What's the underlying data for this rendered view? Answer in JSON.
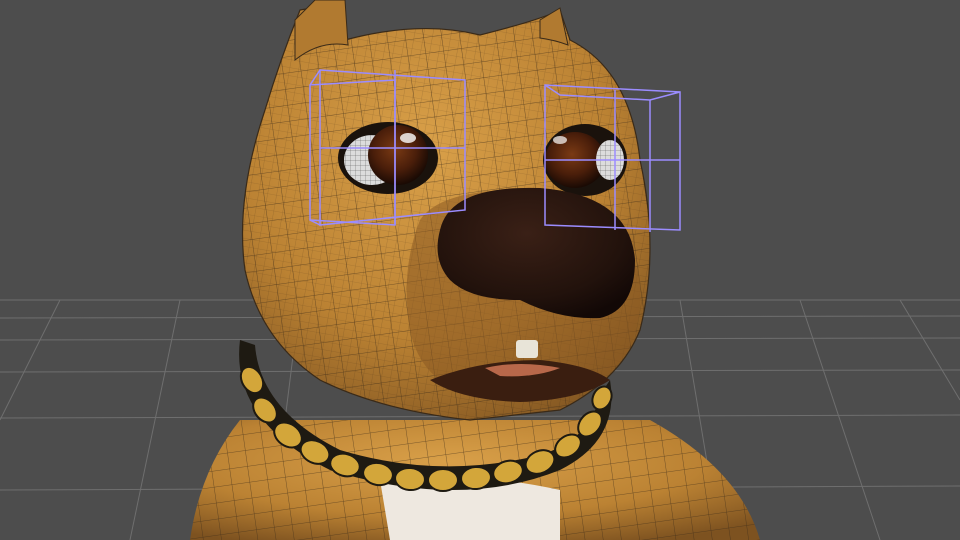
{
  "app": {
    "name": ""
  },
  "viewport": {
    "background": "#4d4d4d",
    "grid_color": "#8a8a8a",
    "selection_color": "#9b8cff"
  },
  "model": {
    "subject": "dog-head",
    "fur_color": "#c38a3a",
    "fur_shadow": "#8a5a22",
    "nose_color": "#2a1710",
    "wireframe_color": "#3a2a18",
    "collar_gold": "#d3a63a",
    "collar_dark": "#1e1a12",
    "chest_color": "#eee8e0",
    "eye_iris": "#5a2a10"
  }
}
